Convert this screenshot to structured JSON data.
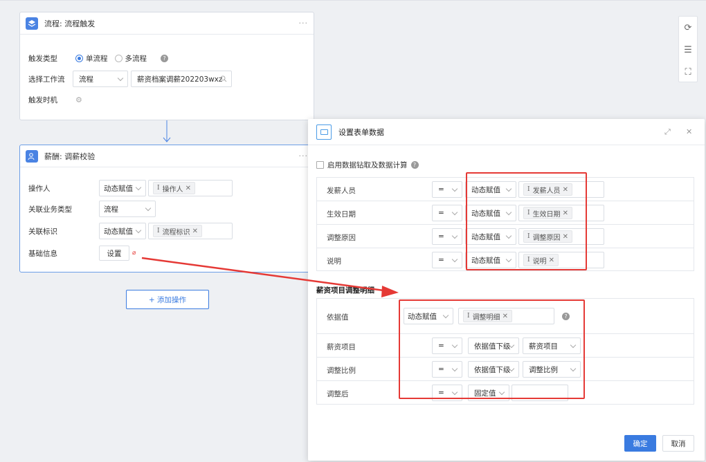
{
  "node1": {
    "title": "流程: 流程触发",
    "more": "···",
    "trigger_type_label": "触发类型",
    "single_label": "单流程",
    "multi_label": "多流程",
    "workflow_label": "选择工作流",
    "workflow_type": "流程",
    "workflow_value": "薪资档案调薪202203wxz",
    "trigger_time_label": "触发时机"
  },
  "node2": {
    "title": "薪酬: 调薪校验",
    "more": "···",
    "operator_label": "操作人",
    "operator_mode": "动态赋值",
    "operator_tag": "操作人",
    "biz_type_label": "关联业务类型",
    "biz_type_value": "流程",
    "rel_id_label": "关联标识",
    "rel_id_mode": "动态赋值",
    "rel_id_tag": "流程标识",
    "base_info_label": "基础信息",
    "set_button": "设置"
  },
  "add_button": "+ 添加操作",
  "dialog": {
    "title": "设置表单数据",
    "enable_label": "启用数据钻取及数据计算",
    "rows": [
      {
        "label": "发薪人员",
        "op": "=",
        "mode": "动态赋值",
        "tag": "发薪人员"
      },
      {
        "label": "生效日期",
        "op": "=",
        "mode": "动态赋值",
        "tag": "生效日期"
      },
      {
        "label": "调整原因",
        "op": "=",
        "mode": "动态赋值",
        "tag": "调整原因"
      },
      {
        "label": "说明",
        "op": "=",
        "mode": "动态赋值",
        "tag": "说明"
      }
    ],
    "section_title": "薪资项目调整明细",
    "basis": {
      "label": "依据值",
      "mode": "动态赋值",
      "tag": "调整明细"
    },
    "rows2": [
      {
        "label": "薪资项目",
        "op": "=",
        "mode": "依据值下级",
        "value": "薪资项目"
      },
      {
        "label": "调整比例",
        "op": "=",
        "mode": "依据值下级",
        "value": "调整比例"
      },
      {
        "label": "调整后",
        "op": "=",
        "mode": "固定值",
        "value": ""
      }
    ],
    "ok": "确定",
    "cancel": "取消"
  },
  "colors": {
    "accent": "#3a7be0",
    "annotation": "#e53935"
  }
}
